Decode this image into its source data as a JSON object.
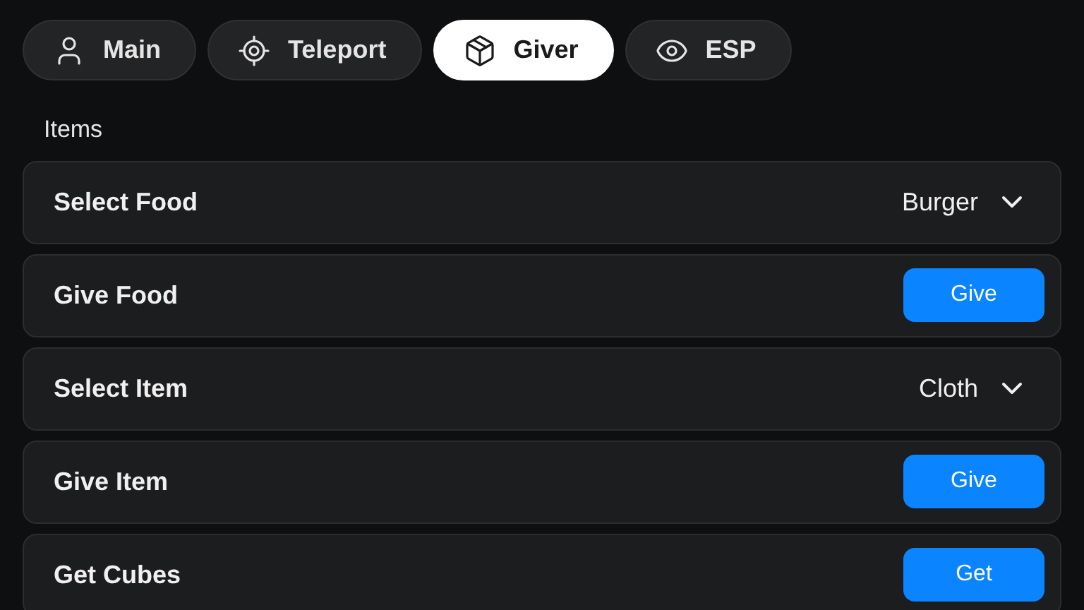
{
  "tabs": [
    {
      "label": "Main",
      "selected": false
    },
    {
      "label": "Teleport",
      "selected": false
    },
    {
      "label": "Giver",
      "selected": true
    },
    {
      "label": "ESP",
      "selected": false
    }
  ],
  "section": {
    "title": "Items"
  },
  "rows": [
    {
      "kind": "dropdown",
      "label": "Select Food",
      "value": "Burger"
    },
    {
      "kind": "button",
      "label": "Give Food",
      "button": "Give"
    },
    {
      "kind": "dropdown",
      "label": "Select Item",
      "value": "Cloth"
    },
    {
      "kind": "button",
      "label": "Give Item",
      "button": "Give"
    },
    {
      "kind": "button",
      "label": "Get Cubes",
      "button": "Get"
    }
  ]
}
